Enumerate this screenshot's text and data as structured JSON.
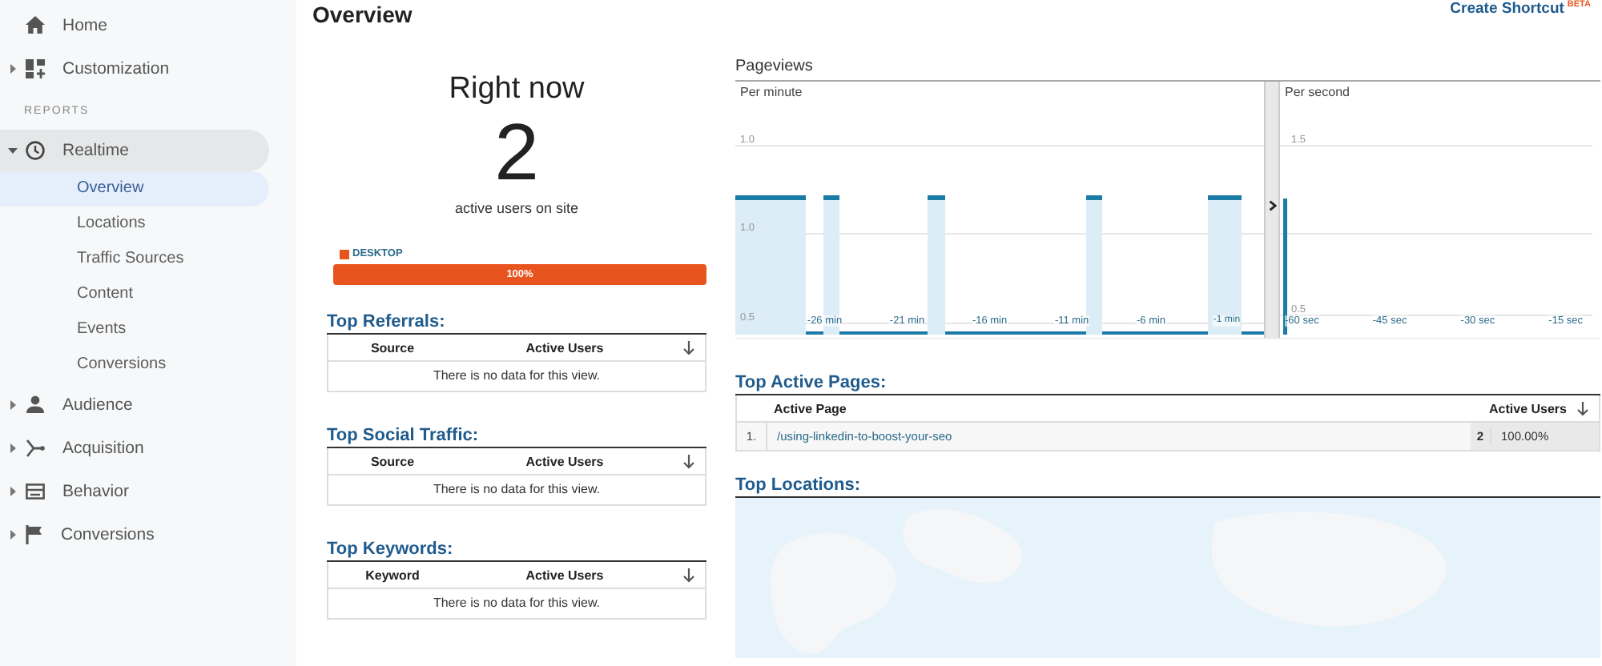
{
  "sidebar": {
    "items": [
      {
        "kind": "nav",
        "label": "Home"
      },
      {
        "kind": "nav",
        "label": "Customization",
        "expanded": false
      },
      {
        "kind": "section",
        "label": "REPORTS"
      },
      {
        "kind": "nav",
        "label": "Realtime",
        "expanded": true,
        "selected": true,
        "children": [
          {
            "label": "Overview",
            "selected": true
          },
          {
            "label": "Locations",
            "selected": false
          },
          {
            "label": "Traffic Sources",
            "selected": false
          },
          {
            "label": "Content",
            "selected": false
          },
          {
            "label": "Events",
            "selected": false
          },
          {
            "label": "Conversions",
            "selected": false
          }
        ]
      },
      {
        "kind": "nav",
        "label": "Audience",
        "expanded": false
      },
      {
        "kind": "nav",
        "label": "Acquisition",
        "expanded": false
      },
      {
        "kind": "nav",
        "label": "Behavior",
        "expanded": false
      },
      {
        "kind": "nav",
        "label": "Conversions",
        "expanded": false
      }
    ]
  },
  "page": {
    "title": "Overview",
    "shortcut": "Create Shortcut",
    "shortcut_badge": "BETA"
  },
  "right_now": {
    "title": "Right now",
    "count": "2",
    "caption": "active users on site",
    "devices": [
      {
        "label": "DESKTOP",
        "color": "#e8541e",
        "level": 1.0,
        "reading": "100%"
      }
    ]
  },
  "pageviews": {
    "title": "Pageviews",
    "per_minute": {
      "title": "Per minute",
      "yticks": [
        "1.0",
        "1.0",
        "0.5"
      ],
      "xticks": [
        "-26 min",
        "-21 min",
        "-16 min",
        "-11 min",
        "-6 min",
        "-1 min"
      ]
    },
    "per_second": {
      "title": "Per second",
      "yticks": [
        "1.5",
        "0.5"
      ],
      "xticks": [
        "-60 sec",
        "-45 sec",
        "-30 sec",
        "-15 sec"
      ]
    }
  },
  "left_tables": [
    {
      "title": "Top Referrals:",
      "columns": [
        "Source",
        "Active Users"
      ],
      "empty_message": "There is no data for this view."
    },
    {
      "title": "Top Social Traffic:",
      "columns": [
        "Source",
        "Active Users"
      ],
      "empty_message": "There is no data for this view."
    },
    {
      "title": "Top Keywords:",
      "columns": [
        "Keyword",
        "Active Users"
      ],
      "empty_message": "There is no data for this view."
    }
  ],
  "top_active_pages": {
    "title": "Top Active Pages:",
    "columns": [
      "Active Page",
      "Active Users"
    ],
    "rows": [
      {
        "index": "1.",
        "page": "/using-linkedin-to-boost-your-seo",
        "users": "2",
        "percent": "100.00%"
      }
    ]
  },
  "top_locations": {
    "title": "Top Locations:"
  }
}
